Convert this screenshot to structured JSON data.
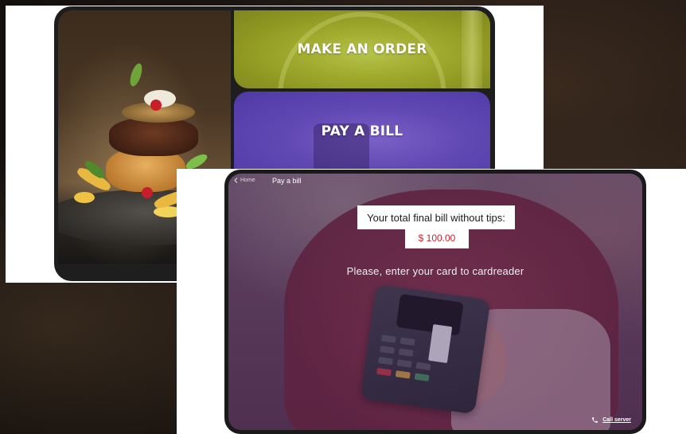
{
  "home_screen": {
    "tiles": [
      {
        "label": "MAKE AN ORDER"
      },
      {
        "label": "PAY A BILL"
      }
    ]
  },
  "bill_screen": {
    "back_label": "Home",
    "title": "Pay a bill",
    "bill_label": "Your total final bill without tips:",
    "bill_amount": "$ 100.00",
    "instruction": "Please, enter your card to cardreader",
    "call_server_label": "Call server"
  },
  "icons": {
    "back": "chevron-left-icon",
    "call": "phone-icon"
  },
  "colors": {
    "order_tile": "#9aa52b",
    "bill_tile": "#6149b4",
    "amount_text": "#d21f2b"
  }
}
